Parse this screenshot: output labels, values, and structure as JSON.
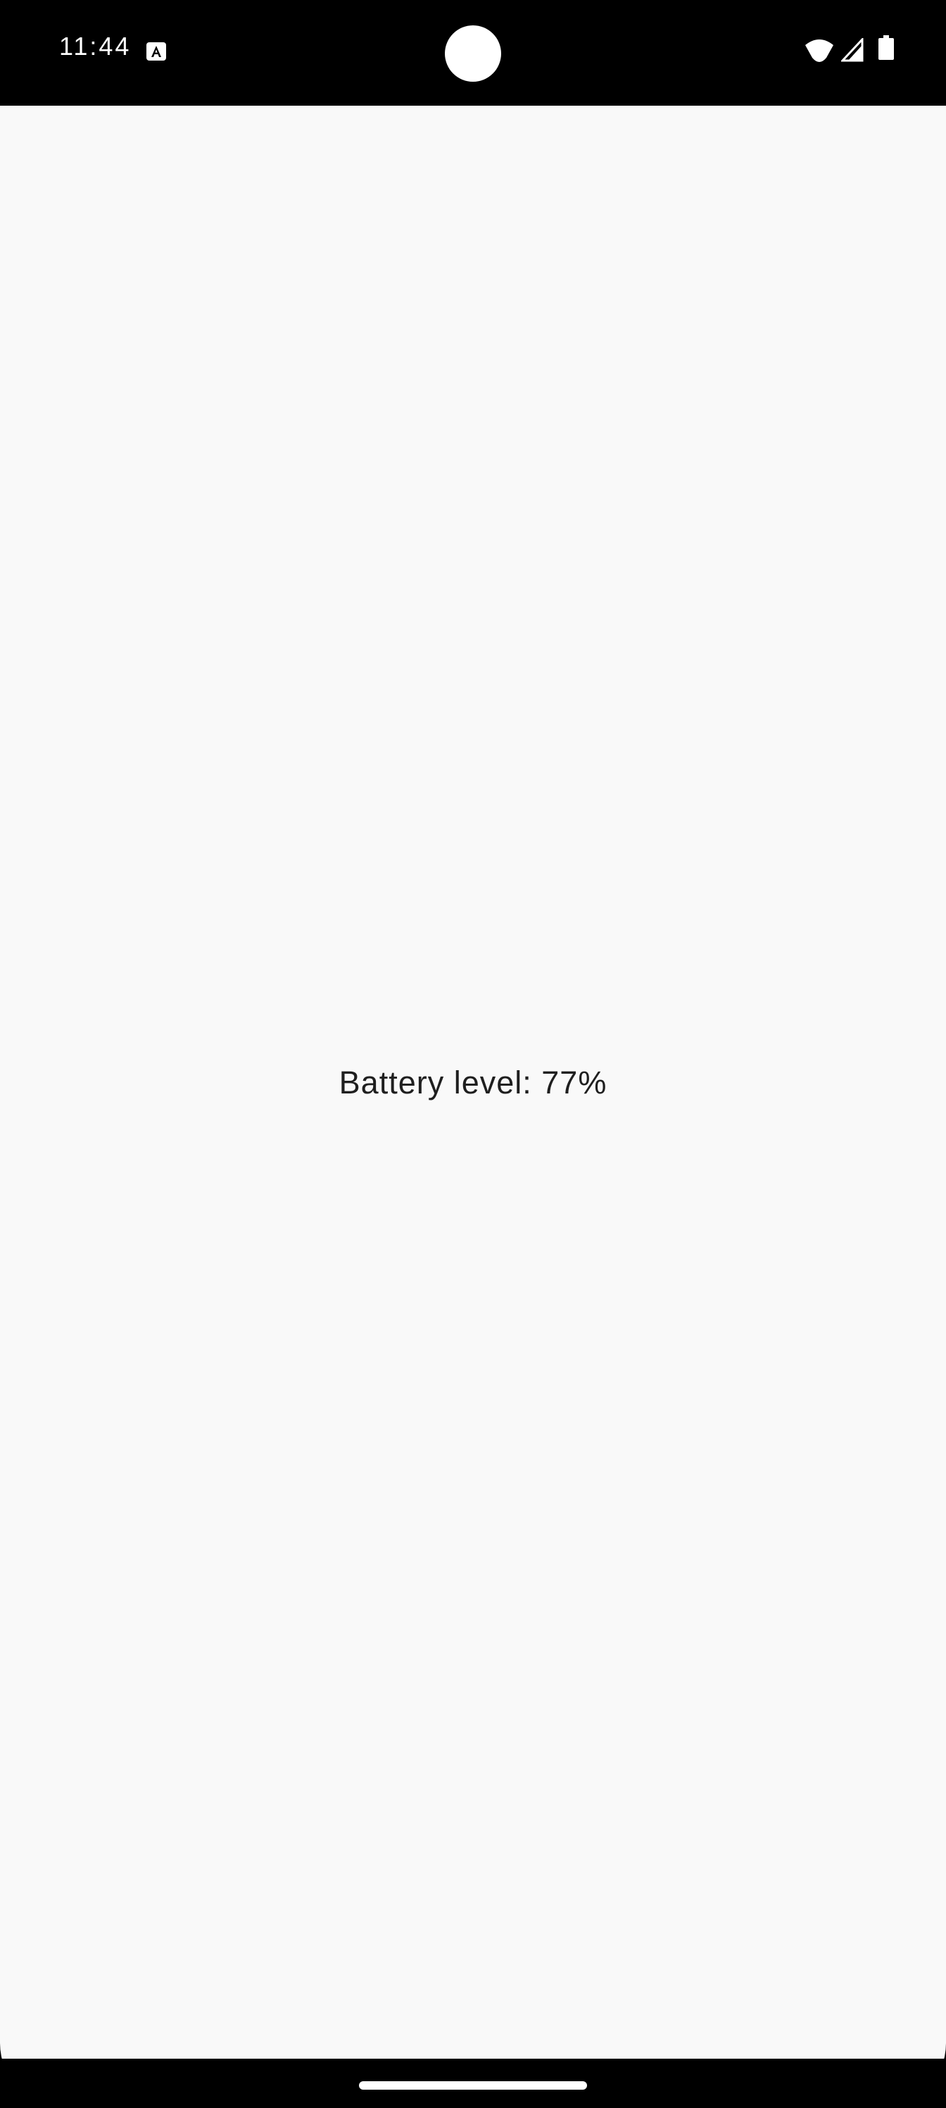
{
  "status_bar": {
    "time": "11:44",
    "notification_icon": "a-icon",
    "wifi_icon": "wifi-icon",
    "cell_icon": "cellular-signal-icon",
    "battery_icon": "battery-icon"
  },
  "main": {
    "battery_text": "Battery level: 77%"
  },
  "colors": {
    "background": "#f9f9f9",
    "text": "#1f1f1f",
    "status_bar": "#000000"
  }
}
